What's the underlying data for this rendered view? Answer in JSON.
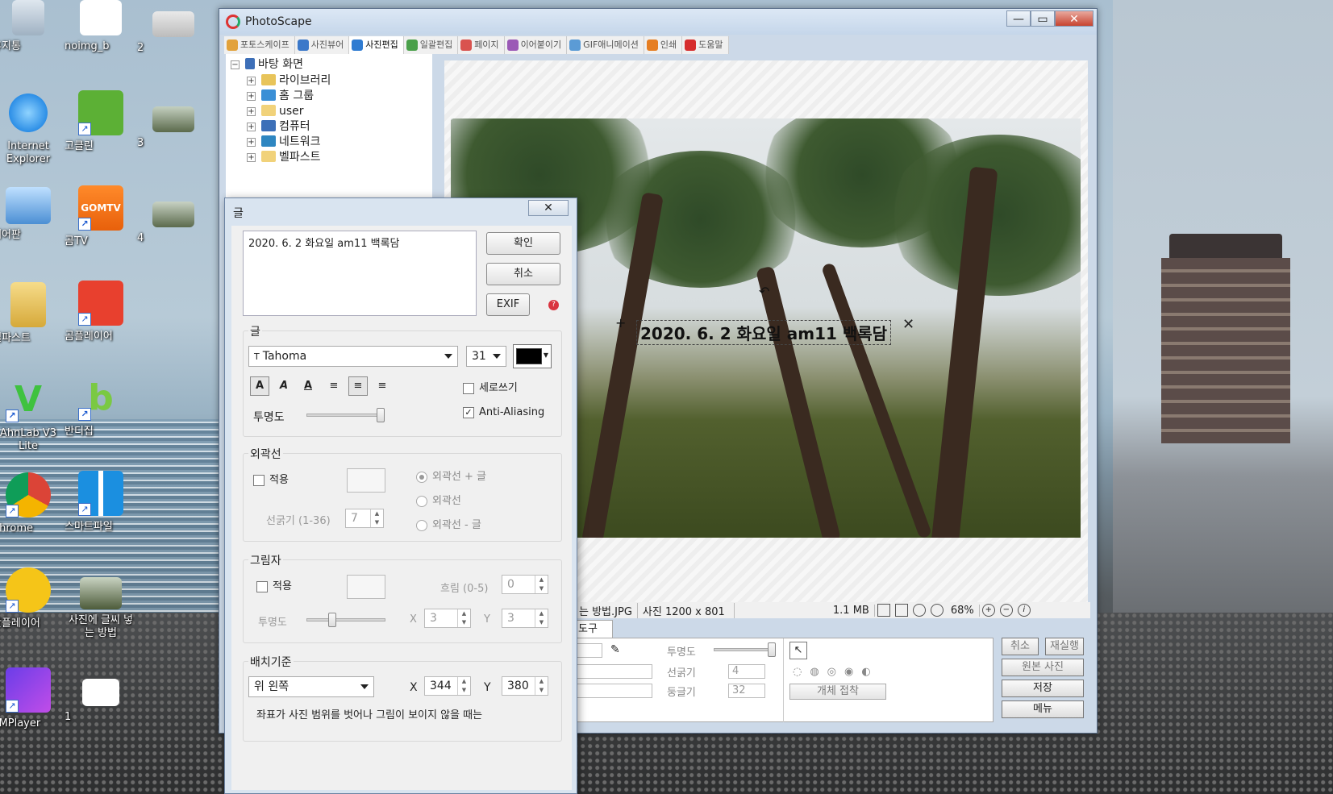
{
  "desktop": {
    "icons": [
      {
        "label": "휴지통"
      },
      {
        "label": "noimg_b"
      },
      {
        "label": "2"
      },
      {
        "label": "Internet Explorer"
      },
      {
        "label": "고클린"
      },
      {
        "label": "3"
      },
      {
        "label": "제어판"
      },
      {
        "label": "곰TV"
      },
      {
        "label": "4"
      },
      {
        "label": "벨파스트"
      },
      {
        "label": "곰플레이어"
      },
      {
        "label": "AhnLab V3 Lite"
      },
      {
        "label": "반디집"
      },
      {
        "label": "Chrome"
      },
      {
        "label": "스마트파일"
      },
      {
        "label": "팟플레이어"
      },
      {
        "label": "사진에 글씨 넣는 방법"
      },
      {
        "label": "KMPlayer"
      },
      {
        "label": "1"
      }
    ]
  },
  "window": {
    "title": "PhotoScape",
    "controls": {
      "minimize": "—",
      "maximize": "▭",
      "close": "✕"
    },
    "tabs": [
      {
        "label": "포토스케이프",
        "color": "#e2a23b"
      },
      {
        "label": "사진뷰어",
        "color": "#3b78c9"
      },
      {
        "label": "사진편집",
        "color": "#2f7bd1"
      },
      {
        "label": "일괄편집",
        "color": "#4aa04a"
      },
      {
        "label": "페이지",
        "color": "#d9534f"
      },
      {
        "label": "이어붙이기",
        "color": "#9b59b6"
      },
      {
        "label": "GIF애니메이션",
        "color": "#5b9bd5"
      },
      {
        "label": "인쇄",
        "color": "#e67e22"
      },
      {
        "label": "도움말",
        "color": "#d62c2c"
      }
    ],
    "tree": {
      "root": "바탕 화면",
      "items": [
        {
          "label": "라이브러리",
          "color": "#e8c45a"
        },
        {
          "label": "홈 그룹",
          "color": "#3a8fd6"
        },
        {
          "label": "user",
          "color": "#f1d27a"
        },
        {
          "label": "컴퓨터",
          "color": "#3c6fb8"
        },
        {
          "label": "네트워크",
          "color": "#2e86c1"
        },
        {
          "label": "벨파스트",
          "color": "#f1d27a"
        }
      ]
    },
    "photo_overlay_text": "2020. 6. 2 화요일 am11  백록담",
    "status": {
      "filename": "는 방법.JPG",
      "dimensions": "사진 1200 x 801",
      "filesize": "1.1 MB",
      "zoom": "68%"
    },
    "bottom_panel": {
      "tab_label": "도구",
      "opacity_label": "투명도",
      "thickness_label": "선굵기",
      "thickness_value": "4",
      "roundness_label": "둥글기",
      "roundness_value": "32",
      "attach_button": "개체 접착"
    },
    "side_buttons": {
      "undo": "취소",
      "redo": "재실행",
      "original": "원본 사진",
      "save": "저장",
      "menu": "메뉴"
    }
  },
  "dialog": {
    "title": "글",
    "close": "✕",
    "text_value": "2020. 6. 2 화요일 am11  백록담",
    "ok_button": "확인",
    "cancel_button": "취소",
    "exif_button": "EXIF",
    "text_group": {
      "title": "글",
      "font": "Tahoma",
      "font_size": "31",
      "color": "#000000",
      "vertical_label": "세로쓰기",
      "antialias_label": "Anti-Aliasing",
      "opacity_label": "투명도",
      "opacity_level": 1.0
    },
    "outline_group": {
      "title": "외곽선",
      "apply_label": "적용",
      "thickness_label": "선굵기 (1-36)",
      "thickness_value": "7",
      "radio_outline_text": "외곽선 + 글",
      "radio_outline": "외곽선",
      "radio_outline_minus": "외곽선 - 글"
    },
    "shadow_group": {
      "title": "그림자",
      "apply_label": "적용",
      "blur_label": "흐림 (0-5)",
      "blur_value": "0",
      "opacity_label": "투명도",
      "opacity_level": 0.3,
      "x_label": "X",
      "x_value": "3",
      "y_label": "Y",
      "y_value": "3"
    },
    "position_group": {
      "title": "배치기준",
      "anchor": "위 왼쪽",
      "x_label": "X",
      "x_value": "344",
      "y_label": "Y",
      "y_value": "380",
      "note": "좌표가 사진 범위를 벗어나 그림이 보이지 않을 때는"
    }
  }
}
